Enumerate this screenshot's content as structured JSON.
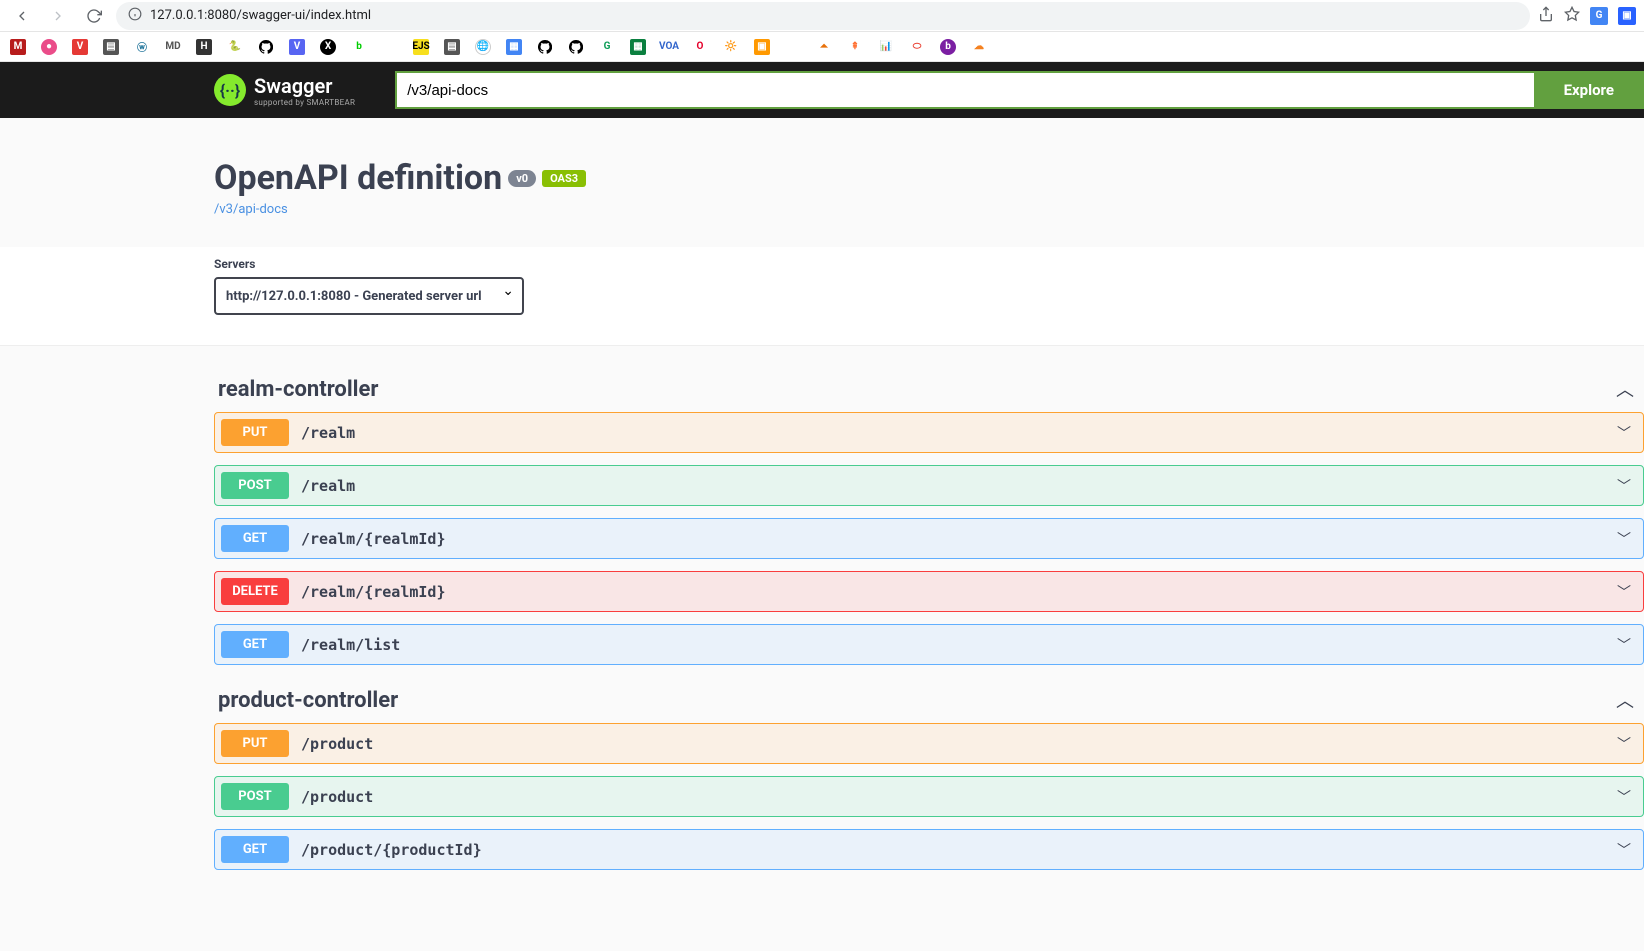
{
  "browser": {
    "url": "127.0.0.1:8080/swagger-ui/index.html"
  },
  "header": {
    "logo_text": "Swagger",
    "logo_sub": "supported by SMARTBEAR",
    "explore_input_value": "/v3/api-docs",
    "explore_button": "Explore"
  },
  "info": {
    "title": "OpenAPI definition",
    "version": "v0",
    "oas": "OAS3",
    "docs_link": "/v3/api-docs"
  },
  "servers": {
    "label": "Servers",
    "selected": "http://127.0.0.1:8080 - Generated server url"
  },
  "tags": [
    {
      "name": "realm-controller",
      "ops": [
        {
          "method": "PUT",
          "cls": "put",
          "path": "/realm"
        },
        {
          "method": "POST",
          "cls": "post",
          "path": "/realm"
        },
        {
          "method": "GET",
          "cls": "get",
          "path": "/realm/{realmId}"
        },
        {
          "method": "DELETE",
          "cls": "delete",
          "path": "/realm/{realmId}"
        },
        {
          "method": "GET",
          "cls": "get",
          "path": "/realm/list"
        }
      ]
    },
    {
      "name": "product-controller",
      "ops": [
        {
          "method": "PUT",
          "cls": "put",
          "path": "/product"
        },
        {
          "method": "POST",
          "cls": "post",
          "path": "/product"
        },
        {
          "method": "GET",
          "cls": "get",
          "path": "/product/{productId}"
        }
      ]
    }
  ]
}
